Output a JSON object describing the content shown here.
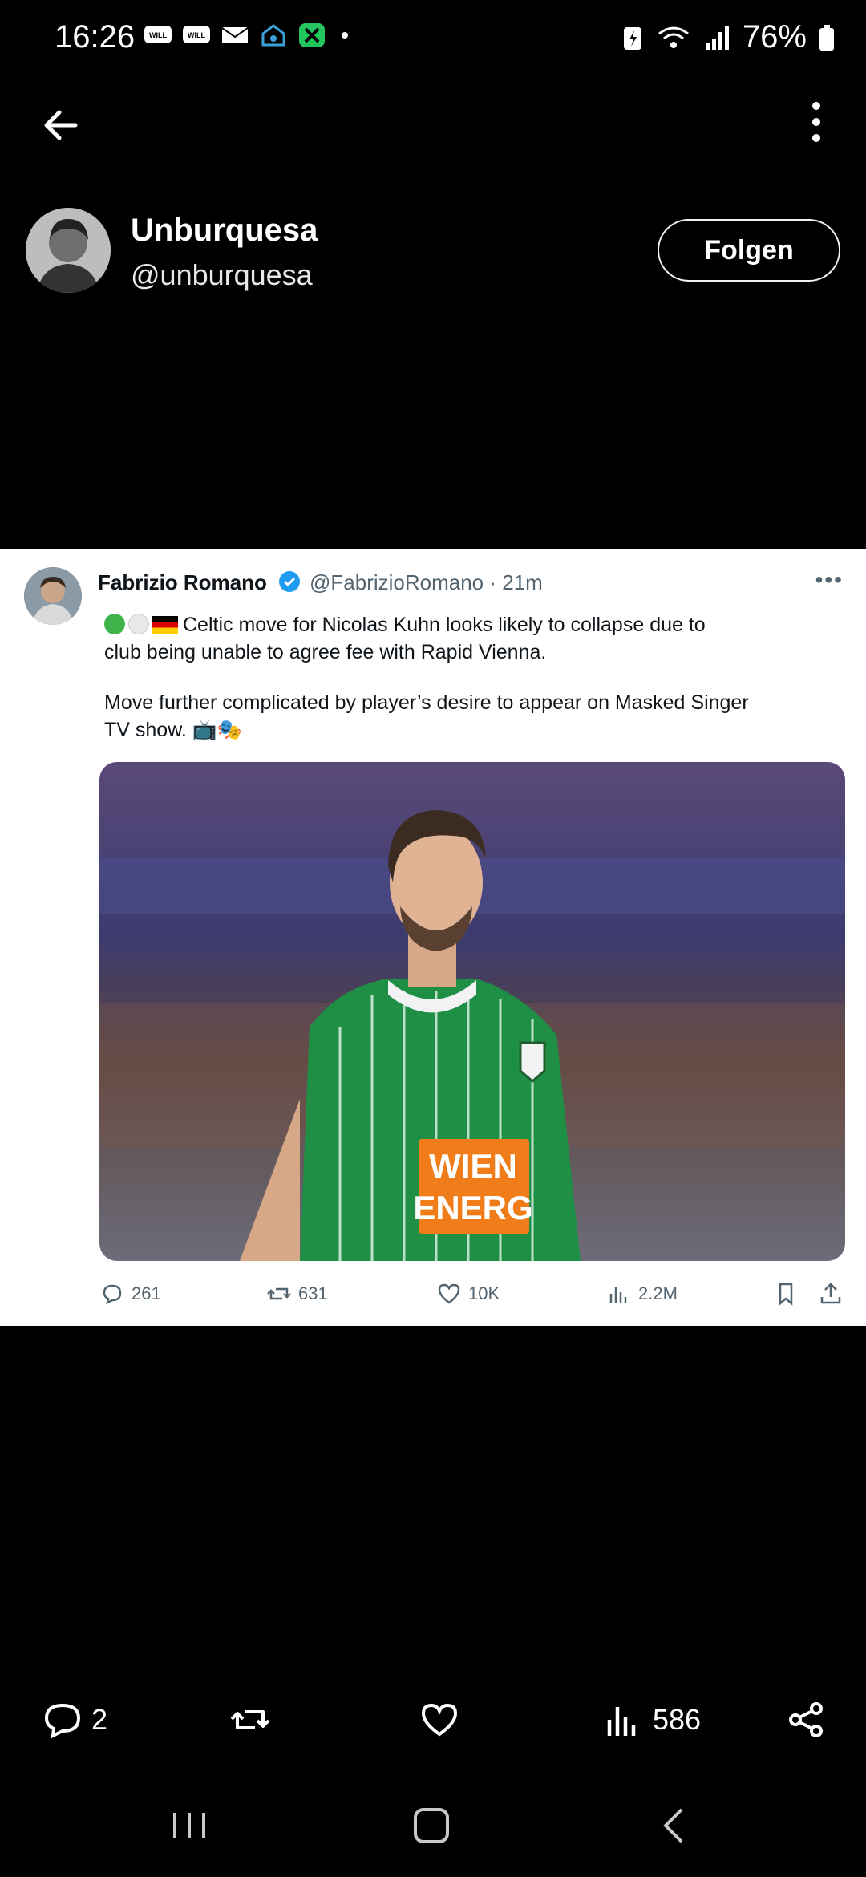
{
  "status_bar": {
    "time": "16:26",
    "battery": "76%"
  },
  "header": {
    "display_name": "Unburquesa",
    "handle": "@unburquesa",
    "follow_label": "Folgen"
  },
  "quoted_tweet": {
    "author_name": "Fabrizio Romano",
    "author_handle_time": "@FabrizioRomano · 21m",
    "text_line1": "Celtic move for Nicolas Kuhn looks likely to collapse due to",
    "text_line2": "club being unable to agree fee with Rapid Vienna.",
    "text_line3": "Move further complicated by player’s desire to appear on Masked Singer",
    "text_line4": "TV show. 📺🎭",
    "jersey_text_1": "WIEN",
    "jersey_text_2": "ENERG",
    "stats": {
      "replies": "261",
      "retweets": "631",
      "likes": "10K",
      "views": "2.2M"
    }
  },
  "post_actions": {
    "replies": "2",
    "views": "586"
  },
  "colors": {
    "background": "#000000",
    "card_background": "#ffffff",
    "verified_blue": "#1d9bf0",
    "jersey_green": "#1f8f45"
  }
}
